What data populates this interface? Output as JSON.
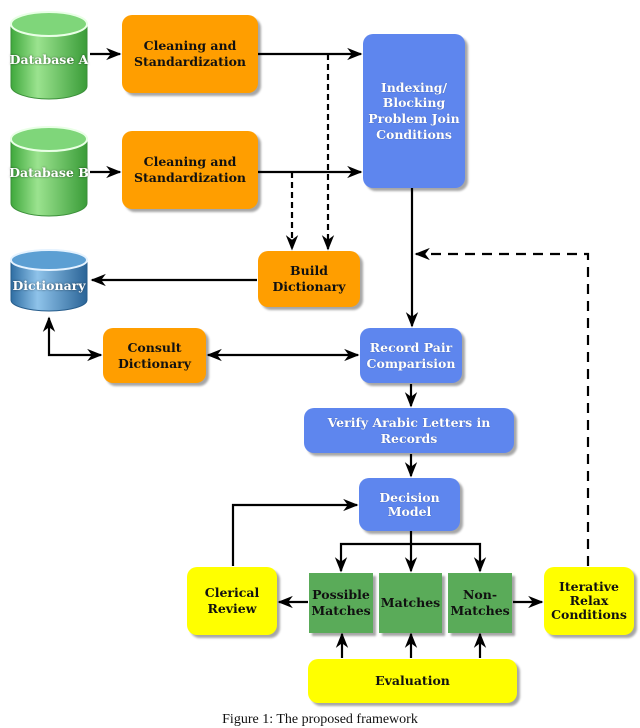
{
  "diagram": {
    "nodes": {
      "database_a": {
        "label": "Database A",
        "shape": "cylinder",
        "color": "#5cc45a"
      },
      "database_b": {
        "label": "Database B",
        "shape": "cylinder",
        "color": "#5cc45a"
      },
      "dictionary": {
        "label": "Dictionary",
        "shape": "cylinder",
        "color": "#3a7fb8"
      },
      "cleaning_a": {
        "label": "Cleaning and Standardization",
        "color": "#ff9e00"
      },
      "cleaning_b": {
        "label": "Cleaning and Standardization",
        "color": "#ff9e00"
      },
      "indexing": {
        "label": "Indexing/ Blocking Problem Join Conditions",
        "color": "#5e86ee"
      },
      "build_dictionary": {
        "label": "Build Dictionary",
        "color": "#ff9e00"
      },
      "consult_dictionary": {
        "label": "Consult Dictionary",
        "color": "#ff9e00"
      },
      "record_pair": {
        "label": "Record Pair Comparision",
        "color": "#5e86ee"
      },
      "verify_arabic": {
        "label": "Verify Arabic Letters in Records",
        "color": "#5e86ee"
      },
      "decision_model": {
        "label": "Decision Model",
        "color": "#5e86ee"
      },
      "clerical_review": {
        "label": "Clerical Review",
        "color": "#ffff00"
      },
      "possible_matches": {
        "label": "Possible Matches",
        "color": "#5aab59"
      },
      "matches": {
        "label": "Matches",
        "color": "#5aab59"
      },
      "non_matches": {
        "label": "Non- Matches",
        "color": "#5aab59"
      },
      "iterative_relax": {
        "label": "Iterative Relax Conditions",
        "color": "#ffff00"
      },
      "evaluation": {
        "label": "Evaluation",
        "color": "#ffff00"
      }
    },
    "edges": [
      {
        "from": "database_a",
        "to": "cleaning_a",
        "style": "solid"
      },
      {
        "from": "database_b",
        "to": "cleaning_b",
        "style": "solid"
      },
      {
        "from": "cleaning_a",
        "to": "indexing",
        "style": "solid"
      },
      {
        "from": "cleaning_b",
        "to": "indexing",
        "style": "solid"
      },
      {
        "from": "cleaning_a",
        "to": "build_dictionary",
        "style": "dashed"
      },
      {
        "from": "cleaning_b",
        "to": "build_dictionary",
        "style": "dashed"
      },
      {
        "from": "build_dictionary",
        "to": "dictionary",
        "style": "solid"
      },
      {
        "from": "indexing",
        "to": "record_pair",
        "style": "solid"
      },
      {
        "from": "dictionary",
        "to": "consult_dictionary",
        "style": "solid",
        "bidirectional": true
      },
      {
        "from": "consult_dictionary",
        "to": "record_pair",
        "style": "solid",
        "bidirectional": true
      },
      {
        "from": "record_pair",
        "to": "verify_arabic",
        "style": "solid"
      },
      {
        "from": "verify_arabic",
        "to": "decision_model",
        "style": "solid"
      },
      {
        "from": "decision_model",
        "to": "possible_matches",
        "style": "solid"
      },
      {
        "from": "decision_model",
        "to": "matches",
        "style": "solid"
      },
      {
        "from": "decision_model",
        "to": "non_matches",
        "style": "solid"
      },
      {
        "from": "possible_matches",
        "to": "clerical_review",
        "style": "solid"
      },
      {
        "from": "clerical_review",
        "to": "decision_model",
        "style": "solid"
      },
      {
        "from": "non_matches",
        "to": "iterative_relax",
        "style": "solid"
      },
      {
        "from": "iterative_relax",
        "to": "indexing_to_record_link",
        "style": "dashed"
      },
      {
        "from": "evaluation",
        "to": "possible_matches",
        "style": "solid"
      },
      {
        "from": "evaluation",
        "to": "matches",
        "style": "solid"
      },
      {
        "from": "evaluation",
        "to": "non_matches",
        "style": "solid"
      }
    ]
  },
  "caption": "Figure 1: The proposed framework"
}
